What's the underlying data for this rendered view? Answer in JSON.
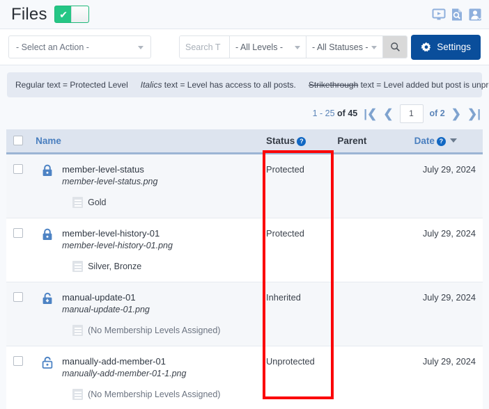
{
  "header": {
    "title": "Files",
    "toggle": {
      "name": "protect-toggle",
      "state": "on",
      "check_glyph": "✔"
    },
    "icons": [
      {
        "name": "video-play-icon",
        "title": "Video"
      },
      {
        "name": "document-search-icon",
        "title": "Search Docs"
      },
      {
        "name": "user-account-icon",
        "title": "Account"
      }
    ]
  },
  "toolbar": {
    "bulk_action": {
      "label": "- Select an Action -"
    },
    "search": {
      "placeholder": "Search T",
      "value": ""
    },
    "levels_filter": {
      "label": "- All Levels -"
    },
    "statuses_filter": {
      "label": "- All Statuses -"
    },
    "search_button": {
      "name": "search-icon"
    },
    "settings": {
      "label": "Settings",
      "color": "#0a4e9b"
    }
  },
  "legend": {
    "regular_prefix": "Regular text",
    "regular": "Regular text = Protected Level",
    "italics_word": "Italics",
    "italics_rest": " text = Level has access to all posts.",
    "strike_word": "Strikethrough",
    "strike_rest": " text = Level added but post is unprotected."
  },
  "pagination": {
    "range": "1 - 25",
    "of_label": "of",
    "total": "45",
    "first": "|❮",
    "prev": "❮",
    "page_value": "1",
    "of_pages": "of 2",
    "next": "❯",
    "last": "❯|"
  },
  "table": {
    "columns": [
      {
        "key": "checkbox",
        "label": ""
      },
      {
        "key": "name",
        "label": "Name",
        "help": false
      },
      {
        "key": "status",
        "label": "Status",
        "help": true
      },
      {
        "key": "parent",
        "label": "Parent",
        "help": false
      },
      {
        "key": "date",
        "label": "Date",
        "help": true,
        "sorted": "desc"
      }
    ],
    "help_glyph": "?",
    "rows": [
      {
        "lock": "locked",
        "name": "member-level-status",
        "file": "member-level-status.png",
        "levels": "Gold",
        "levels_muted": false,
        "status": "Protected",
        "parent": "",
        "date": "July 29, 2024"
      },
      {
        "lock": "locked",
        "name": "member-level-history-01",
        "file": "member-level-history-01.png",
        "levels": "Silver, Bronze",
        "levels_muted": false,
        "status": "Protected",
        "parent": "",
        "date": "July 29, 2024"
      },
      {
        "lock": "inherited",
        "name": "manual-update-01",
        "file": "manual-update-01.png",
        "levels": "(No Membership Levels Assigned)",
        "levels_muted": true,
        "status": "Inherited",
        "parent": "",
        "date": "July 29, 2024"
      },
      {
        "lock": "unlocked",
        "name": "manually-add-member-01",
        "file": "manually-add-member-01-1.png",
        "levels": "(No Membership Levels Assigned)",
        "levels_muted": true,
        "status": "Unprotected",
        "parent": "",
        "date": "July 29, 2024"
      }
    ]
  },
  "annotation": {
    "name": "status-column-highlight",
    "color": "#fb0407"
  }
}
